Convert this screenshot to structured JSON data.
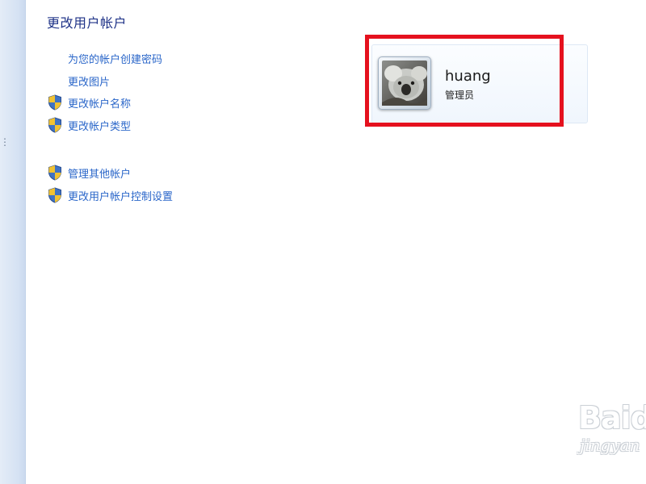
{
  "page": {
    "title": "更改用户帐户"
  },
  "tasks": {
    "create_password": "为您的帐户创建密码",
    "change_picture": "更改图片",
    "change_name": "更改帐户名称",
    "change_type": "更改帐户类型",
    "manage_other": "管理其他帐户",
    "uac_settings": "更改用户帐户控制设置"
  },
  "user": {
    "name": "huang",
    "role": "管理员"
  },
  "watermark": {
    "logo": "Baidu",
    "sub": "jingyan"
  },
  "colors": {
    "title": "#1e3287",
    "link": "#2a66c9",
    "highlight": "#e5111e",
    "sidebar": "#d5e2f3"
  }
}
